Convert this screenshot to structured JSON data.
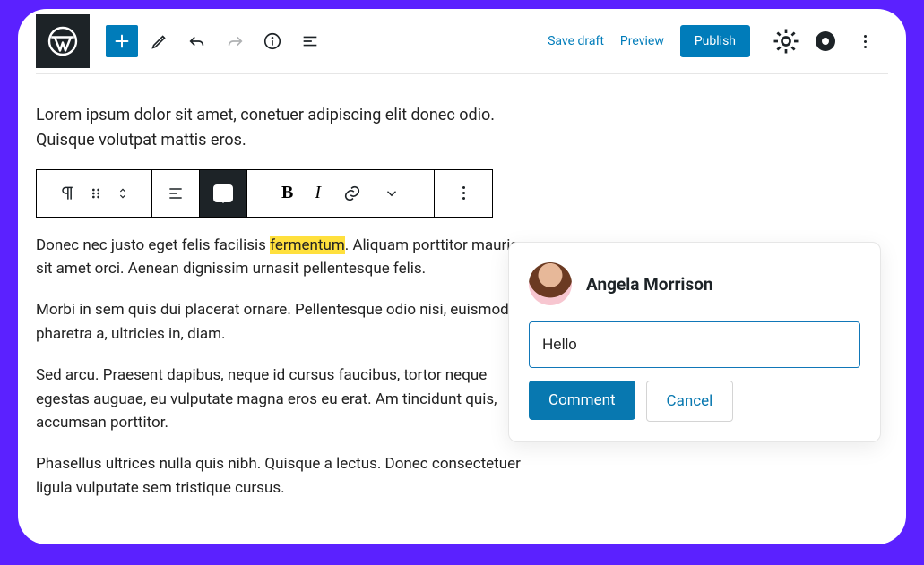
{
  "header": {
    "save_draft": "Save draft",
    "preview": "Preview",
    "publish": "Publish"
  },
  "intro_para": "Lorem ipsum dolor sit amet, conetuer adipiscing elit donec odio. Quisque volutpat mattis eros.",
  "block_toolbar": {
    "bold": "B",
    "italic": "I"
  },
  "paragraphs": {
    "p1_before": "Donec nec justo eget felis facilisis ",
    "p1_highlight": "fermentum",
    "p1_after": ". Aliquam porttitor mauris sit amet orci. Aenean dignissim urnasit pellentesque felis.",
    "p2": "Morbi in sem quis dui placerat ornare. Pellentesque odio nisi, euismod in, pharetra a, ultricies in, diam.",
    "p3": "Sed arcu. Praesent dapibus, neque id cursus faucibus, tortor neque egestas auguae, eu vulputate magna eros eu erat. Am tincidunt quis, accumsan porttitor.",
    "p4": "Phasellus ultrices nulla quis nibh. Quisque a lectus. Donec consectetuer ligula vulputate sem tristique cursus."
  },
  "comment_popover": {
    "user_name": "Angela Morrison",
    "input_value": "Hello",
    "comment_label": "Comment",
    "cancel_label": "Cancel"
  },
  "colors": {
    "frame": "#5b21ff",
    "accent": "#007cba",
    "highlight": "#ffe03d"
  }
}
